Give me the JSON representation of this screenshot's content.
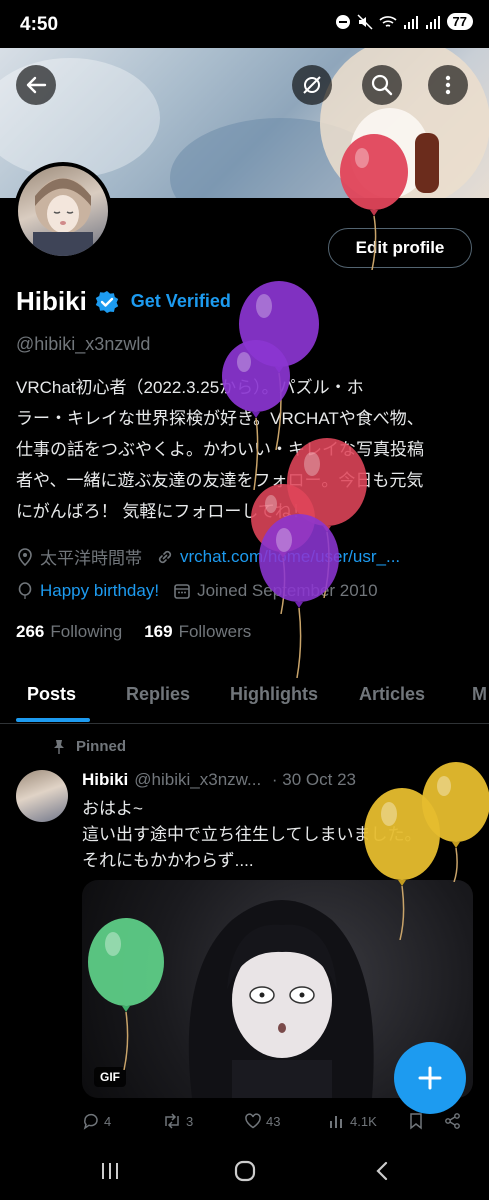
{
  "status_bar": {
    "time": "4:50",
    "battery": "77"
  },
  "profile": {
    "edit_profile_label": "Edit profile",
    "display_name": "Hibiki",
    "get_verified_label": "Get Verified",
    "handle": "@hibiki_x3nzwld",
    "bio_lines": [
      "VRChat初心者（2022.3.25から）。パズル・ホ",
      "ラー・キレイな世界探検が好き。VRCHATや食べ物、",
      "仕事の話をつぶやくよ。かわいい・キレイな写真投稿",
      "者や、一緒に遊ぶ友達の友達をフォロー。今日も元気",
      "にがんばろ！ 気軽にフォローしてね！"
    ],
    "location": "太平洋時間帯",
    "website": "vrchat.com/home/user/usr_...",
    "birthday_label": "Happy birthday!",
    "joined": "Joined September 2010",
    "following_count": "266",
    "following_label": "Following",
    "followers_count": "169",
    "followers_label": "Followers"
  },
  "tabs": [
    "Posts",
    "Replies",
    "Highlights",
    "Articles",
    "M"
  ],
  "pinned_tweet": {
    "pinned_label": "Pinned",
    "name": "Hibiki",
    "handle": "@hibiki_x3nzw...",
    "date": "· 30 Oct 23",
    "text_lines": [
      "おはよ~",
      "這い出す途中で立ち往生してしまいました。",
      "それにもかかわらず...."
    ],
    "media_badge": "GIF",
    "replies": "4",
    "reposts": "3",
    "likes": "43",
    "views": "4.1K"
  },
  "colors": {
    "accent": "#1d9bf0",
    "muted": "#71767b",
    "balloon_red": "#e0455a",
    "balloon_purple": "#8b35d1",
    "balloon_yellow": "#e6bd2e",
    "balloon_green": "#5fd38a"
  },
  "icons": {
    "back": "arrow-left-icon",
    "no_tag": "tag-off-icon",
    "search": "search-icon",
    "more": "more-vertical-icon",
    "verified": "verified-badge-icon",
    "location": "location-pin-icon",
    "link": "link-icon",
    "birthday": "balloon-icon",
    "calendar": "calendar-icon",
    "pin": "pin-icon"
  }
}
